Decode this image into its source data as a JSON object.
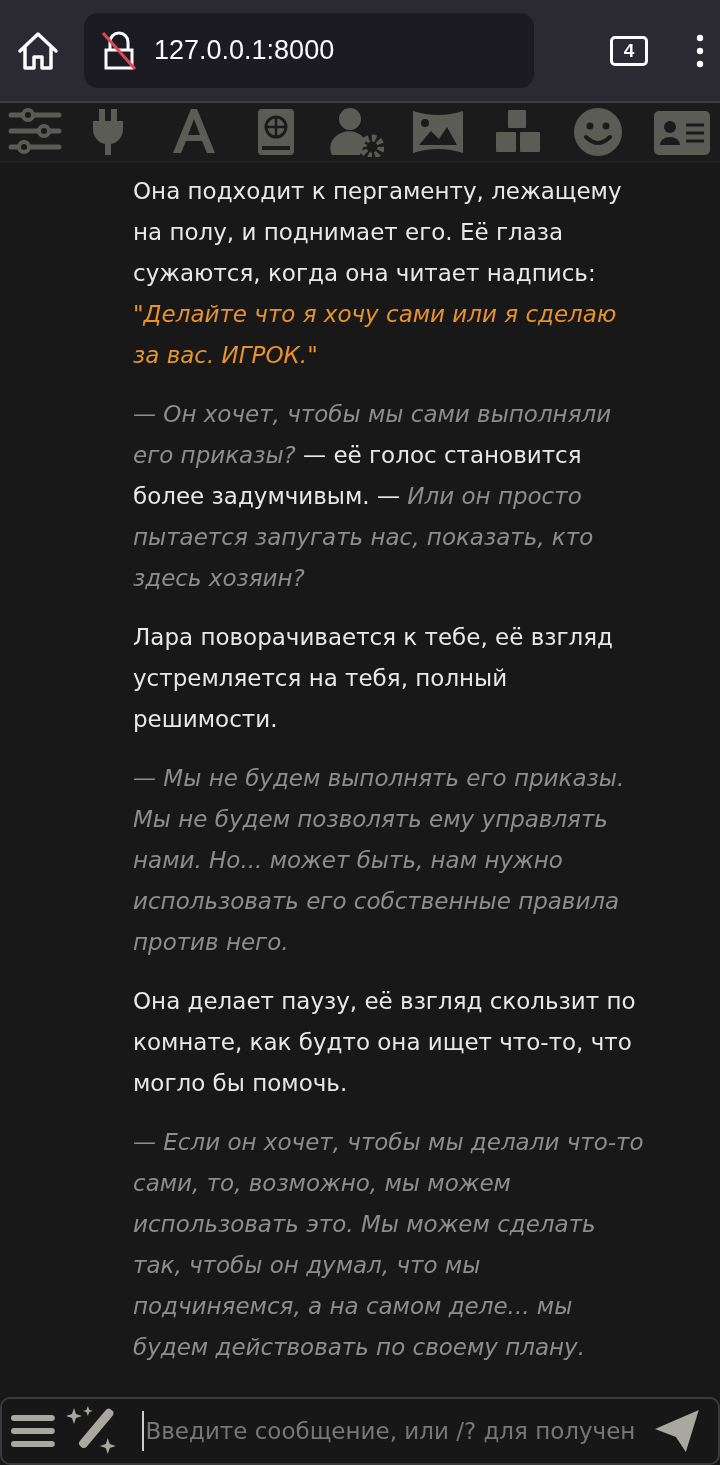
{
  "browser": {
    "url": "127.0.0.1:8000",
    "tab_count": "4"
  },
  "paragraphs": [
    {
      "segments": [
        {
          "kind": "text",
          "text": "Она подходит к пергаменту, лежащему на полу, и поднимает его. Её глаза сужаются, когда она читает надпись:"
        },
        {
          "kind": "quote",
          "text": "\"Делайте что я хочу сами или я сделаю за вас. ИГРОК.\""
        }
      ]
    },
    {
      "segments": [
        {
          "kind": "speech",
          "text": "— Он хочет, чтобы мы сами выполняли его приказы?"
        },
        {
          "kind": "text",
          "text": " — её голос становится более задумчивым. — "
        },
        {
          "kind": "speech",
          "text": "Или он просто пытается запугать нас, показать, кто здесь хозяин?"
        }
      ]
    },
    {
      "segments": [
        {
          "kind": "text",
          "text": "Лара поворачивается к тебе, её взгляд устремляется на тебя, полный решимости."
        }
      ]
    },
    {
      "segments": [
        {
          "kind": "speech",
          "text": "— Мы не будем выполнять его приказы. Мы не будем позволять ему управлять нами. Но... может быть, нам нужно использовать его собственные правила против него."
        }
      ]
    },
    {
      "segments": [
        {
          "kind": "text",
          "text": "Она делает паузу, её взгляд скользит по комнате, как будто она ищет что-то, что могло бы помочь."
        }
      ]
    },
    {
      "segments": [
        {
          "kind": "speech",
          "text": "— Если он хочет, чтобы мы делали что-то сами, то, возможно, мы можем использовать это. Мы можем сделать так, чтобы он думал, что мы подчиняемся, а на самом деле... мы будем действовать по своему плану."
        }
      ]
    }
  ],
  "input": {
    "placeholder": "Введите сообщение, или /? для получен"
  }
}
